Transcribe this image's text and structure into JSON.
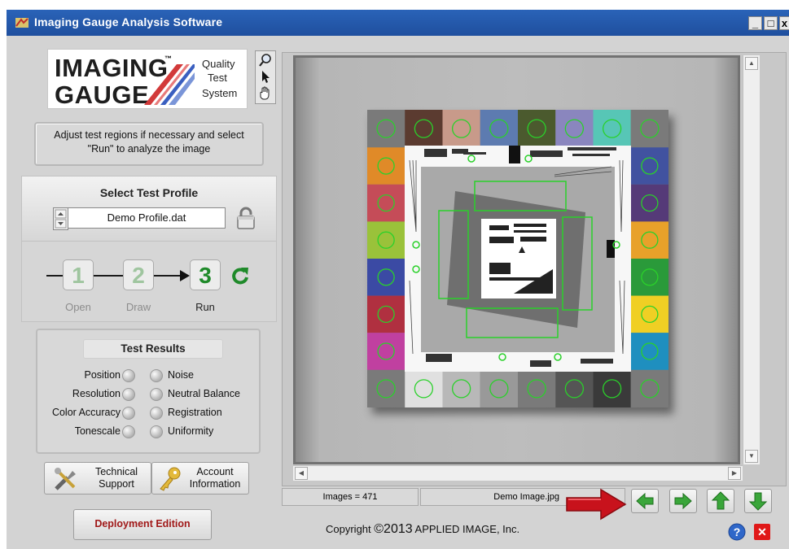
{
  "window": {
    "title": "Imaging Gauge Analysis Software",
    "min_label": "_",
    "max_label": "□",
    "close_label": "x"
  },
  "logo": {
    "word1": "IMAGING",
    "word2": "GAUGE",
    "tm": "™",
    "tag1": "Quality",
    "tag2": "Test",
    "tag3": "System"
  },
  "tools": [
    "magnifier-icon",
    "arrow-pointer-icon",
    "hand-icon"
  ],
  "instruction": "Adjust test regions if necessary and select \"Run\" to analyze the image",
  "profile": {
    "title": "Select Test Profile",
    "value": "Demo Profile.dat"
  },
  "steps": [
    {
      "number": "1",
      "label": "Open",
      "color": "#9fc59f"
    },
    {
      "number": "2",
      "label": "Draw",
      "color": "#9fc59f"
    },
    {
      "number": "3",
      "label": "Run",
      "color": "#1f8a2a"
    }
  ],
  "results": {
    "title": "Test Results",
    "left": [
      "Position",
      "Resolution",
      "Color Accuracy",
      "Tonescale"
    ],
    "right": [
      "Noise",
      "Neutral Balance",
      "Registration",
      "Uniformity"
    ]
  },
  "buttons": {
    "technical_line1": "Technical",
    "technical_line2": "Support",
    "account_line1": "Account",
    "account_line2": "Information",
    "deployment": "Deployment Edition"
  },
  "status": {
    "images": "Images = 471",
    "file": "Demo Image.jpg"
  },
  "copyright": {
    "prefix": "Copyright ",
    "symbol_year": "©2013",
    "suffix": " APPLIED IMAGE, Inc."
  },
  "nav_buttons": [
    "arrow-left-icon",
    "arrow-right-icon",
    "arrow-up-icon",
    "arrow-down-icon"
  ],
  "colors": {
    "accent_green": "#1f8a2a",
    "title_bar": "#2a63b8",
    "deploy_red": "#a01818",
    "roi_green": "#2ad12a"
  },
  "chart_top_patches": [
    "#7a7a7a",
    "#5b3b30",
    "#c89a8a",
    "#5d7bb0",
    "#4b5a2e",
    "#8a86be",
    "#57c6b6",
    "#7a7a7a"
  ],
  "chart_bottom_patches": [
    "#7a7a7a",
    "#e0e0e0",
    "#b8b8b8",
    "#999999",
    "#7a7a7a",
    "#555555",
    "#3a3a3a",
    "#7a7a7a"
  ],
  "chart_left_patches": [
    "#e08a28",
    "#c54c58",
    "#9ac23a",
    "#3b4aa4",
    "#b03040",
    "#c040a0"
  ],
  "chart_right_patches": [
    "#4152a0",
    "#553a78",
    "#e8a12a",
    "#2a9a3a",
    "#f0cf24",
    "#1f8fbf"
  ]
}
